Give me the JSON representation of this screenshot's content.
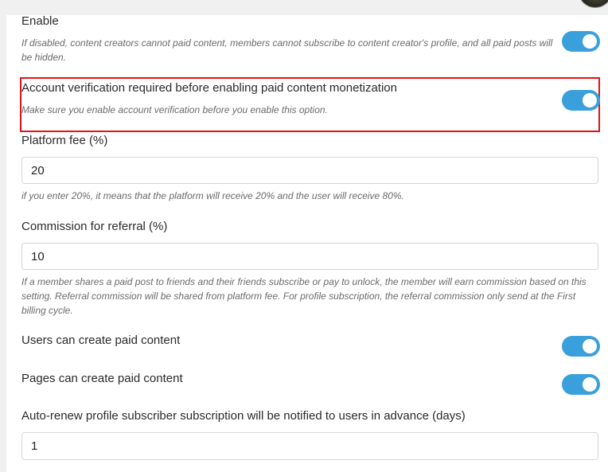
{
  "settings": {
    "enable": {
      "label": "Enable",
      "help": "If disabled, content creators cannot paid content, members cannot subscribe to content creator's profile, and all paid posts will be hidden.",
      "on": true
    },
    "verification": {
      "label": "Account verification required before enabling paid content monetization",
      "help": "Make sure you enable account verification before you enable this option.",
      "on": true
    },
    "platform_fee": {
      "label": "Platform fee (%)",
      "value": "20",
      "help": "if you enter 20%, it means that the platform will receive 20% and the user will receive 80%."
    },
    "commission": {
      "label": "Commission for referral (%)",
      "value": "10",
      "help": "If a member shares a paid post to friends and their friends subscribe or pay to unlock, the member will earn commission based on this setting. Referral commission will be shared from platform fee. For profile subscription, the referral commission only send at the First billing cycle."
    },
    "users_paid": {
      "label": "Users can create paid content",
      "on": true
    },
    "pages_paid": {
      "label": "Pages can create paid content",
      "on": true
    },
    "auto_renew": {
      "label": "Auto-renew profile subscriber subscription will be notified to users in advance (days)",
      "value": "1"
    }
  },
  "colors": {
    "toggle_on": "#3aa0dc",
    "highlight": "#e0141a"
  }
}
